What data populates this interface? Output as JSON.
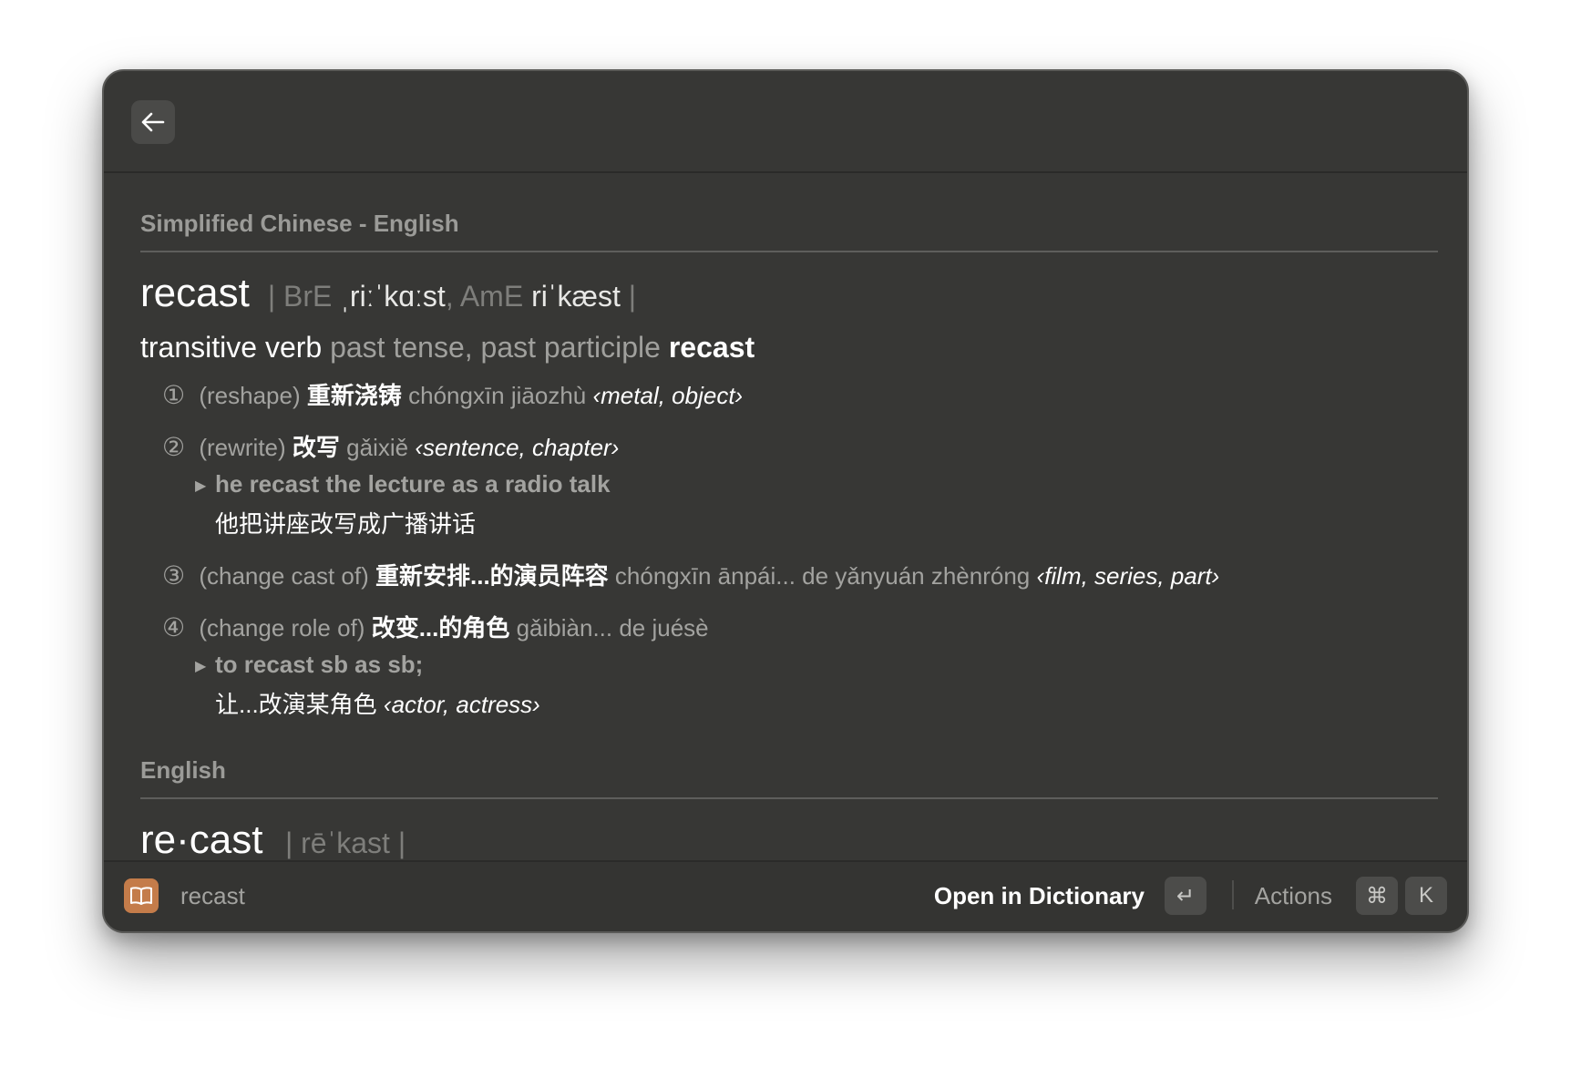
{
  "header": {
    "back_icon": "arrow-left-icon"
  },
  "sections": [
    {
      "title": "Simplified Chinese - English",
      "headword": "recast",
      "pron_open": "| BrE ",
      "pron_bre": "ˌriːˈkɑːst",
      "pron_mid": ", AmE ",
      "pron_ame": "riˈkæst",
      "pron_close": " |",
      "pos": "transitive verb",
      "forms_label": "past tense, past participle",
      "forms_value": "recast",
      "senses": [
        {
          "num": "①",
          "gloss": "(reshape)",
          "zh": "重新浇铸",
          "pinyin": "chóngxīn jiāozhù",
          "context": "‹metal, object›"
        },
        {
          "num": "②",
          "gloss": "(rewrite)",
          "zh": "改写",
          "pinyin": "gǎixiě",
          "context": "‹sentence, chapter›",
          "example_en": "he recast the lecture as a radio talk",
          "example_zh": "他把讲座改写成广播讲话"
        },
        {
          "num": "③",
          "gloss": "(change cast of)",
          "zh": "重新安排...的演员阵容",
          "pinyin": "chóngxīn ānpái... de yǎnyuán zhènróng",
          "context": "‹film, series, part›"
        },
        {
          "num": "④",
          "gloss": "(change role of)",
          "zh": "改变...的角色",
          "pinyin": "gǎibiàn... de juésè",
          "example_en": "to recast sb as sb;",
          "example_zh": "让...改演某角色",
          "example_context": "‹actor, actress›"
        }
      ]
    },
    {
      "title": "English",
      "headword": "re·cast",
      "pron": "| rēˈkast |"
    }
  ],
  "footer": {
    "app_icon": "book-icon",
    "query": "recast",
    "open_label": "Open in Dictionary",
    "open_key": "↵",
    "actions_label": "Actions",
    "actions_key_1": "⌘",
    "actions_key_2": "K"
  }
}
